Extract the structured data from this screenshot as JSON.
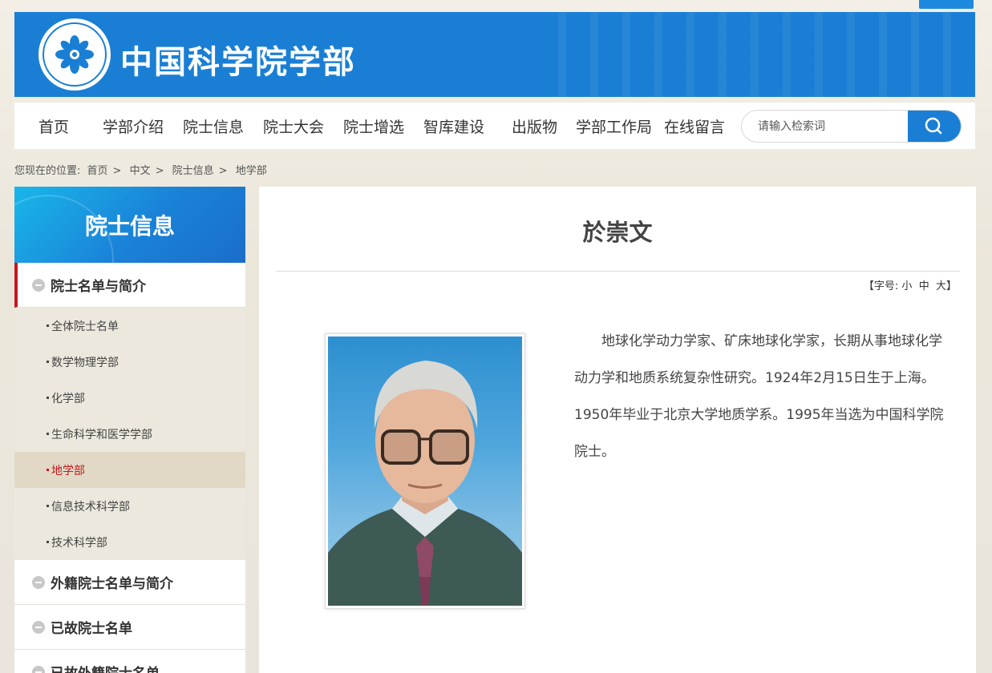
{
  "site": {
    "title": "中国科学院学部",
    "logo_icon": "cas-logo-icon"
  },
  "nav": {
    "items": [
      "首页",
      "学部介绍",
      "院士信息",
      "院士大会",
      "院士增选",
      "智库建设",
      "出版物",
      "学部工作局",
      "在线留言"
    ],
    "search_placeholder": "请输入检索词"
  },
  "breadcrumb": {
    "label": "您现在的位置:",
    "items": [
      "首页",
      "中文",
      "院士信息",
      "地学部"
    ],
    "separator": ">"
  },
  "sidebar": {
    "title": "院士信息",
    "groups": [
      {
        "label": "院士名单与简介",
        "active": true
      },
      {
        "label": "外籍院士名单与简介"
      },
      {
        "label": "已故院士名单"
      },
      {
        "label": "已故外籍院士名单"
      }
    ],
    "sub_items": [
      "全体院士名单",
      "数学物理学部",
      "化学部",
      "生命科学和医学学部",
      "地学部",
      "信息技术科学部",
      "技术科学部"
    ],
    "current_sub": "地学部"
  },
  "content": {
    "name": "於崇文",
    "font_size_label": "【字号:",
    "font_sizes": [
      "小",
      "中",
      "大"
    ],
    "font_size_close": "】",
    "bio": "地球化学动力学家、矿床地球化学家，长期从事地球化学动力学和地质系统复杂性研究。1924年2月15日生于上海。1950年毕业于北京大学地质学系。1995年当选为中国科学院院士。"
  },
  "colors": {
    "brand_blue": "#1a7fd4",
    "accent_red": "#c7161e"
  }
}
